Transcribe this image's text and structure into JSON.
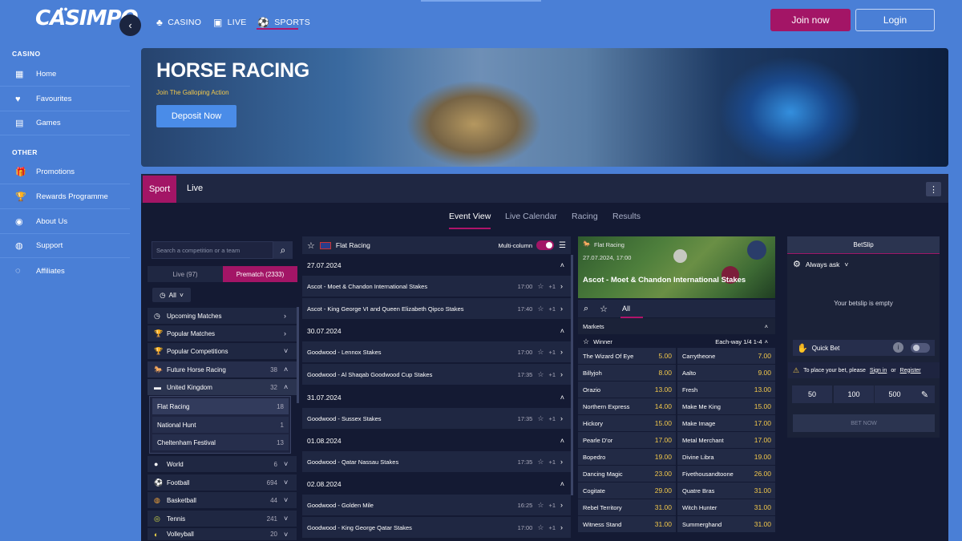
{
  "brand": {
    "logo": "CASIMPO"
  },
  "topnav": [
    {
      "icon": "♣",
      "label": "CASINO"
    },
    {
      "icon": "▣",
      "label": "LIVE"
    },
    {
      "icon": "⚽",
      "label": "SPORTS"
    }
  ],
  "auth": {
    "join": "Join now",
    "login": "Login"
  },
  "sidebar": {
    "casino_head": "CASINO",
    "casino_items": [
      {
        "icon": "▦",
        "label": "Home"
      },
      {
        "icon": "♥",
        "label": "Favourites"
      },
      {
        "icon": "▤",
        "label": "Games"
      }
    ],
    "other_head": "OTHER",
    "other_items": [
      {
        "icon": "🎁",
        "label": "Promotions"
      },
      {
        "icon": "🏆",
        "label": "Rewards Programme"
      },
      {
        "icon": "◉",
        "label": "About Us"
      },
      {
        "icon": "◍",
        "label": "Support"
      },
      {
        "icon": "◌",
        "label": "Affiliates"
      }
    ]
  },
  "banner": {
    "title": "HORSE RACING",
    "subtitle": "Join The Galloping Action",
    "cta": "Deposit Now"
  },
  "main_tabs": {
    "sport": "Sport",
    "live": "Live"
  },
  "sub_tabs": [
    "Event View",
    "Live Calendar",
    "Racing",
    "Results"
  ],
  "left": {
    "search_placeholder": "Search a competition or a team",
    "live_tab": "Live (97)",
    "prematch_tab": "Prematch (2333)",
    "filter": "All",
    "rows": [
      {
        "icon": "◷",
        "label": "Upcoming Matches",
        "count": "",
        "chev": "›"
      },
      {
        "icon": "🏆",
        "label": "Popular Matches",
        "count": "",
        "chev": "›"
      },
      {
        "icon": "🏆",
        "label": "Popular Competitions",
        "count": "",
        "chev": "˅"
      },
      {
        "icon": "🐎",
        "label": "Future Horse Racing",
        "count": "38",
        "chev": "˄"
      },
      {
        "icon": "▬",
        "label": "United Kingdom",
        "count": "32",
        "chev": "˄"
      }
    ],
    "sub_rows": [
      {
        "label": "Flat Racing",
        "count": "18"
      },
      {
        "label": "National Hunt",
        "count": "1"
      },
      {
        "label": "Cheltenham Festival",
        "count": "13"
      }
    ],
    "sport_rows": [
      {
        "icon": "●",
        "label": "World",
        "count": "6",
        "chev": "˅"
      },
      {
        "icon": "⚽",
        "label": "Football",
        "count": "694",
        "chev": "˅"
      },
      {
        "icon": "◍",
        "label": "Basketball",
        "count": "44",
        "chev": "˅"
      },
      {
        "icon": "◎",
        "label": "Tennis",
        "count": "241",
        "chev": "˅"
      },
      {
        "icon": "◐",
        "label": "Volleyball",
        "count": "20",
        "chev": "˅"
      }
    ]
  },
  "middle": {
    "title": "Flat Racing",
    "multi_column": "Multi-column",
    "groups": [
      {
        "date": "27.07.2024",
        "events": [
          {
            "name": "Ascot - Moet & Chandon International Stakes",
            "time": "17:00",
            "plus": "+1"
          },
          {
            "name": "Ascot - King George VI and Queen Elizabeth Qipco Stakes",
            "time": "17:40",
            "plus": "+1"
          }
        ]
      },
      {
        "date": "30.07.2024",
        "events": [
          {
            "name": "Goodwood - Lennox Stakes",
            "time": "17:00",
            "plus": "+1"
          },
          {
            "name": "Goodwood - Al Shaqab Goodwood Cup Stakes",
            "time": "17:35",
            "plus": "+1"
          }
        ]
      },
      {
        "date": "31.07.2024",
        "events": [
          {
            "name": "Goodwood - Sussex Stakes",
            "time": "17:35",
            "plus": "+1"
          }
        ]
      },
      {
        "date": "01.08.2024",
        "events": [
          {
            "name": "Goodwood - Qatar Nassau Stakes",
            "time": "17:35",
            "plus": "+1"
          }
        ]
      },
      {
        "date": "02.08.2024",
        "events": [
          {
            "name": "Goodwood - Golden Mile",
            "time": "16:25",
            "plus": "+1"
          },
          {
            "name": "Goodwood - King George Qatar Stakes",
            "time": "17:00",
            "plus": "+1"
          }
        ]
      }
    ]
  },
  "markets": {
    "category": "Flat Racing",
    "datetime": "27.07.2024, 17:00",
    "event": "Ascot - Moet & Chandon International Stakes",
    "all": "All",
    "markets_label": "Markets",
    "winner": "Winner",
    "each_way": "Each-way 1/4 1-4",
    "runners": [
      [
        "The Wizard Of Eye",
        "5.00",
        "Carrytheone",
        "7.00"
      ],
      [
        "Billyjoh",
        "8.00",
        "Aalto",
        "9.00"
      ],
      [
        "Orazio",
        "13.00",
        "Fresh",
        "13.00"
      ],
      [
        "Northern Express",
        "14.00",
        "Make Me King",
        "15.00"
      ],
      [
        "Hickory",
        "15.00",
        "Make Image",
        "17.00"
      ],
      [
        "Pearle D'or",
        "17.00",
        "Metal Merchant",
        "17.00"
      ],
      [
        "Bopedro",
        "19.00",
        "Divine Libra",
        "19.00"
      ],
      [
        "Dancing Magic",
        "23.00",
        "Fivethousandtoone",
        "26.00"
      ],
      [
        "Cogitate",
        "29.00",
        "Quatre Bras",
        "31.00"
      ],
      [
        "Rebel Territory",
        "31.00",
        "Witch Hunter",
        "31.00"
      ],
      [
        "Witness Stand",
        "31.00",
        "Summerghand",
        "31.00"
      ]
    ]
  },
  "betslip": {
    "title": "BetSlip",
    "always_ask": "Always ask",
    "empty": "Your betslip is empty",
    "quick_bet": "Quick Bet",
    "warn_prefix": "To place your bet, please",
    "sign_in": "Sign in",
    "or": "or",
    "register": "Register",
    "stakes": [
      "50",
      "100",
      "500"
    ],
    "bet_now": "BET NOW"
  }
}
